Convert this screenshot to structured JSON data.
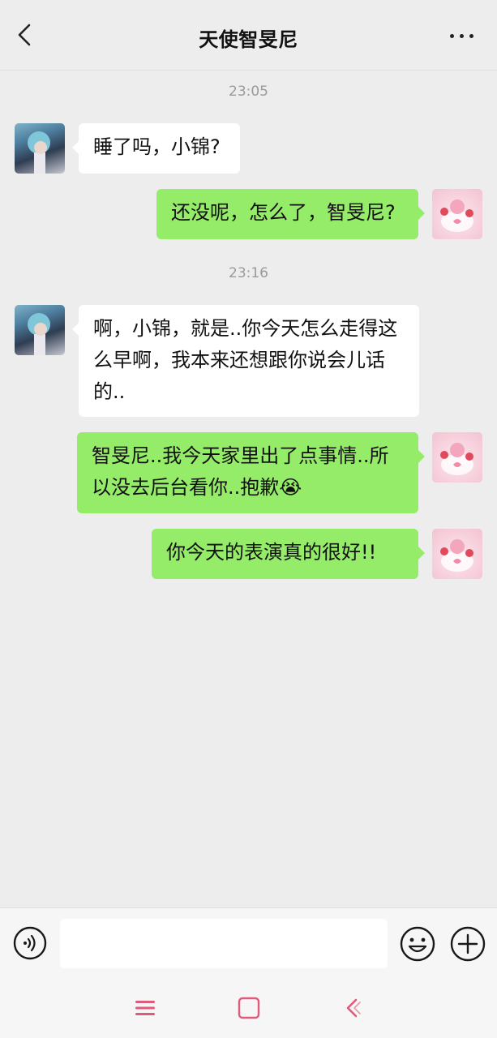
{
  "header": {
    "title": "天使智旻尼",
    "back_icon": "chevron-left-icon",
    "more_icon": "more-horizontal-icon"
  },
  "messages": [
    {
      "type": "time",
      "text": "23:05"
    },
    {
      "type": "msg",
      "from": "other",
      "text": "睡了吗，小锦?"
    },
    {
      "type": "msg",
      "from": "self",
      "text": "还没呢，怎么了，智旻尼?"
    },
    {
      "type": "time",
      "text": "23:16"
    },
    {
      "type": "msg",
      "from": "other",
      "text": "啊，小锦，就是..你今天怎么走得这么早啊，我本来还想跟你说会儿话的.."
    },
    {
      "type": "msg",
      "from": "self",
      "text": "智旻尼..我今天家里出了点事情..所以没去后台看你..抱歉😭"
    },
    {
      "type": "msg",
      "from": "self",
      "text": "你今天的表演真的很好!!"
    }
  ],
  "input_bar": {
    "message_value": "",
    "voice_icon": "voice-icon",
    "emoji_icon": "emoji-icon",
    "plus_icon": "plus-icon"
  },
  "system_nav": {
    "menu_icon": "menu-icon",
    "home_icon": "home-square-icon",
    "back_icon": "back-chevron-icon"
  },
  "colors": {
    "background": "#ededed",
    "self_bubble": "#95ec69",
    "other_bubble": "#ffffff",
    "timestamp": "#9a9a9a",
    "nav_accent": "#e05a7a"
  }
}
